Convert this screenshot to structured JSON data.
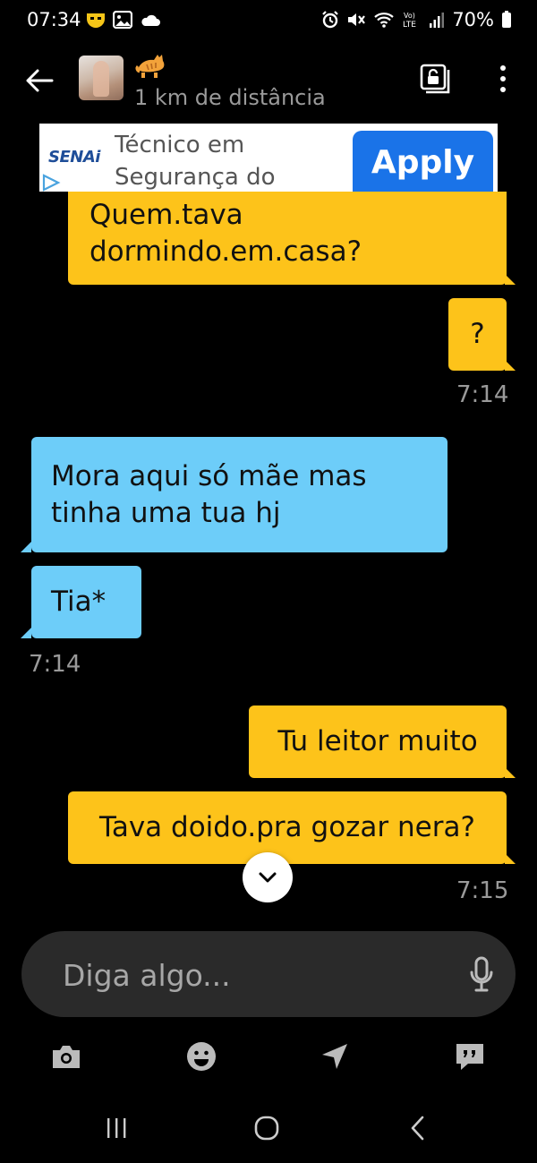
{
  "status": {
    "time": "07:34",
    "battery": "70%",
    "network": "LTE"
  },
  "header": {
    "distance": "1 km de distância"
  },
  "ad": {
    "brand": "SENAi",
    "text": "Técnico em Segurança do",
    "cta": "Apply"
  },
  "messages": [
    {
      "from": "me",
      "text": "Quem.tava dormindo.em.casa?"
    },
    {
      "from": "me",
      "text": "?",
      "time": "7:14"
    },
    {
      "from": "them",
      "text": "Mora aqui só mãe mas tinha uma tua hj"
    },
    {
      "from": "them",
      "text": "Tia*",
      "time": "7:14"
    },
    {
      "from": "me",
      "text": "Tu leitor muito"
    },
    {
      "from": "me",
      "text": "Tava doido.pra gozar nera?",
      "time": "7:15"
    }
  ],
  "composer": {
    "placeholder": "Diga algo..."
  },
  "colors": {
    "sent_bubble": "#fdc31a",
    "received_bubble": "#6dcdf9",
    "background": "#000000",
    "ad_cta": "#1a73e8"
  },
  "icons": {
    "toolbar": [
      "camera-icon",
      "smiley-icon",
      "location-arrow-icon",
      "quick-phrases-icon"
    ],
    "nav": [
      "recent-apps-icon",
      "home-icon",
      "back-nav-icon"
    ]
  }
}
